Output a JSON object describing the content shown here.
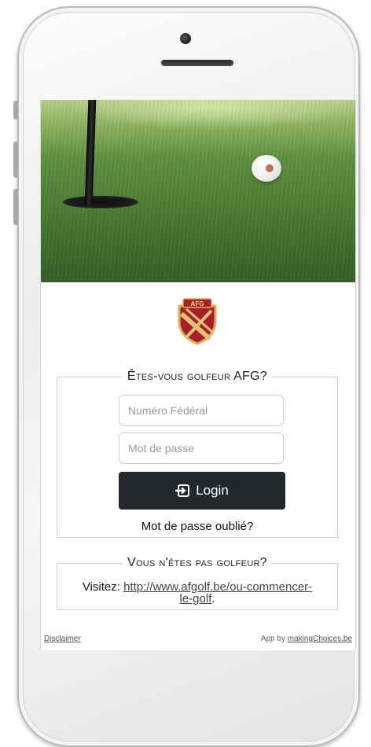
{
  "logo": {
    "text": "AFG"
  },
  "golfer_section": {
    "legend": "Êtes-vous golfeur AFG?",
    "federal_number": {
      "placeholder": "Numéro Fédéral",
      "value": ""
    },
    "password": {
      "placeholder": "Mot de passe",
      "value": ""
    },
    "login_label": "Login",
    "forgot_password": "Mot de passe oublié?"
  },
  "non_golfer_section": {
    "legend": "Vous n'êtes pas golfeur?",
    "visit_label": "Visitez:",
    "link_line1": "http://www.afgolf.be/ou-commencer-",
    "link_line2": "le-golf",
    "trailing": "."
  },
  "footer": {
    "disclaimer": "Disclaimer",
    "app_by_prefix": "App by",
    "app_by_link": "makingChoices.be"
  },
  "colors": {
    "login_button": "#24282d",
    "shield_red": "#a81e2a",
    "shield_gold": "#d9b25a"
  },
  "icons": [
    "login-arrow-icon",
    "afg-shield-logo",
    "golf-flagstick",
    "golf-ball"
  ]
}
